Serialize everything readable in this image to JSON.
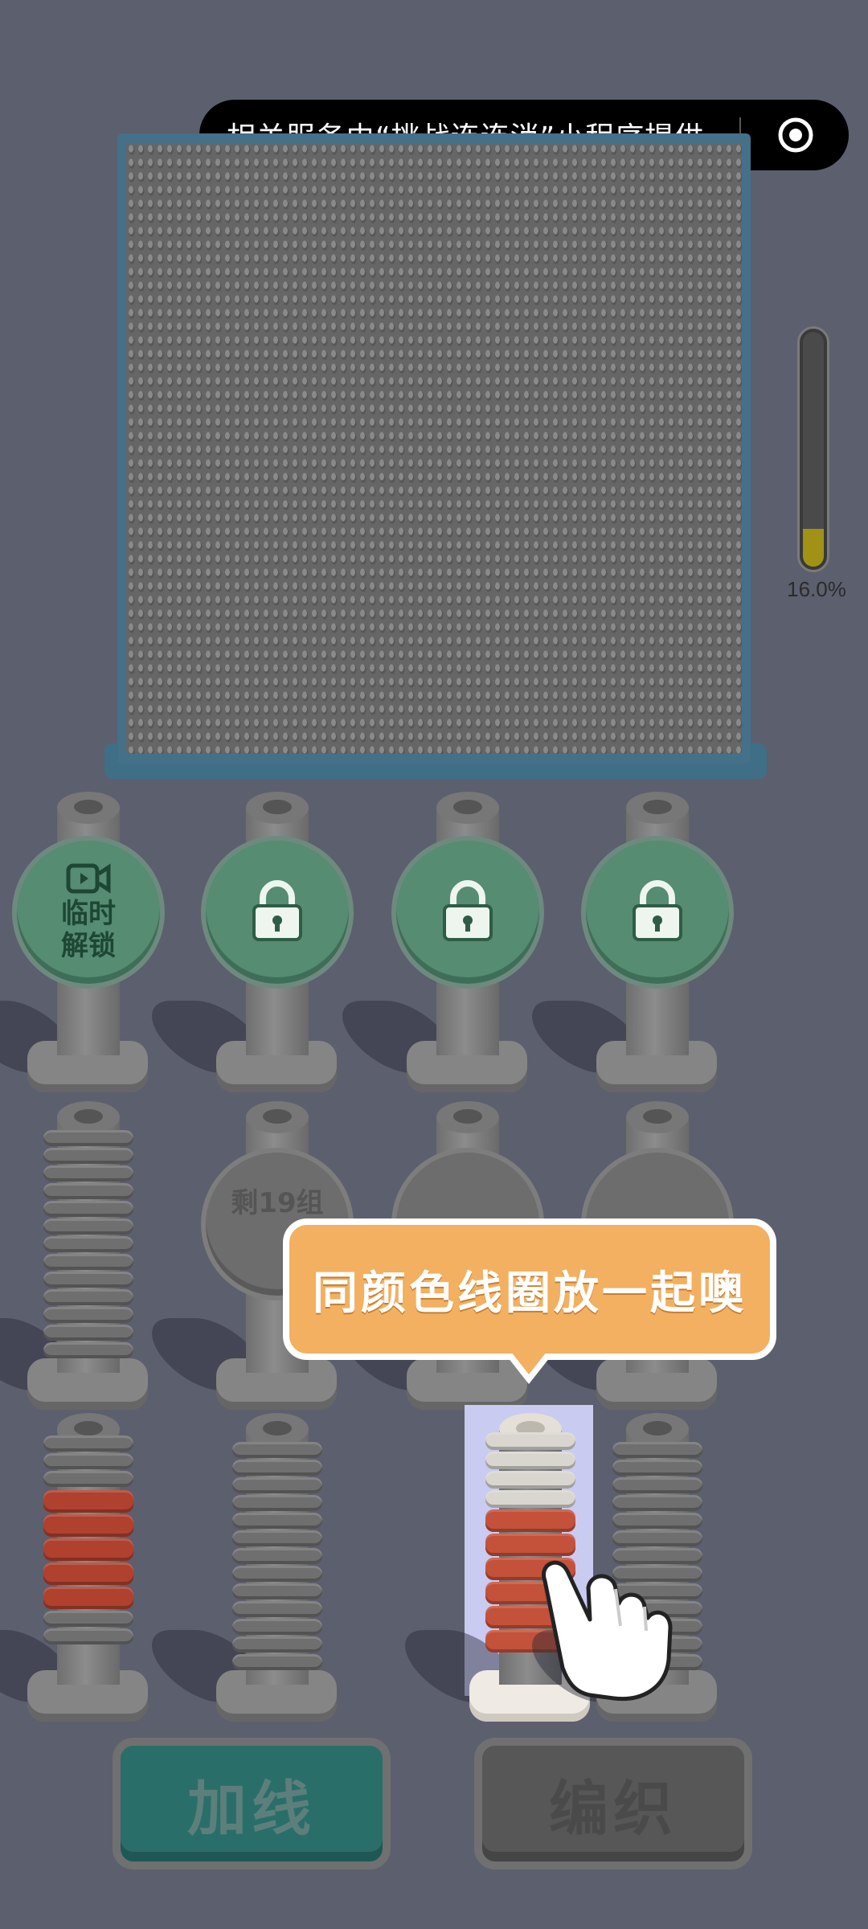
{
  "capsule": {
    "text": "相关服务由“挑战连连消”小程序提供",
    "icon": "target-icon"
  },
  "progress": {
    "label": "16.0%",
    "value": 0.16
  },
  "lock_row": [
    {
      "type": "temp-unlock",
      "label": "临时\n解锁",
      "icon": "video-icon"
    },
    {
      "type": "locked",
      "icon": "lock-icon"
    },
    {
      "type": "locked",
      "icon": "lock-icon"
    },
    {
      "type": "locked",
      "icon": "lock-icon"
    }
  ],
  "middle_row": {
    "partial_label": "剩19组"
  },
  "tooltip": {
    "text": "同颜色线圈放一起噢"
  },
  "buttons": {
    "add_thread": "加线",
    "weave": "编织"
  },
  "colors": {
    "red_thread": "#b0412f",
    "white_thread": "#d9d6d0",
    "gray_thread": "#6f6f6f",
    "teal_button": "#2a6e6a",
    "tooltip": "#f2b060"
  }
}
